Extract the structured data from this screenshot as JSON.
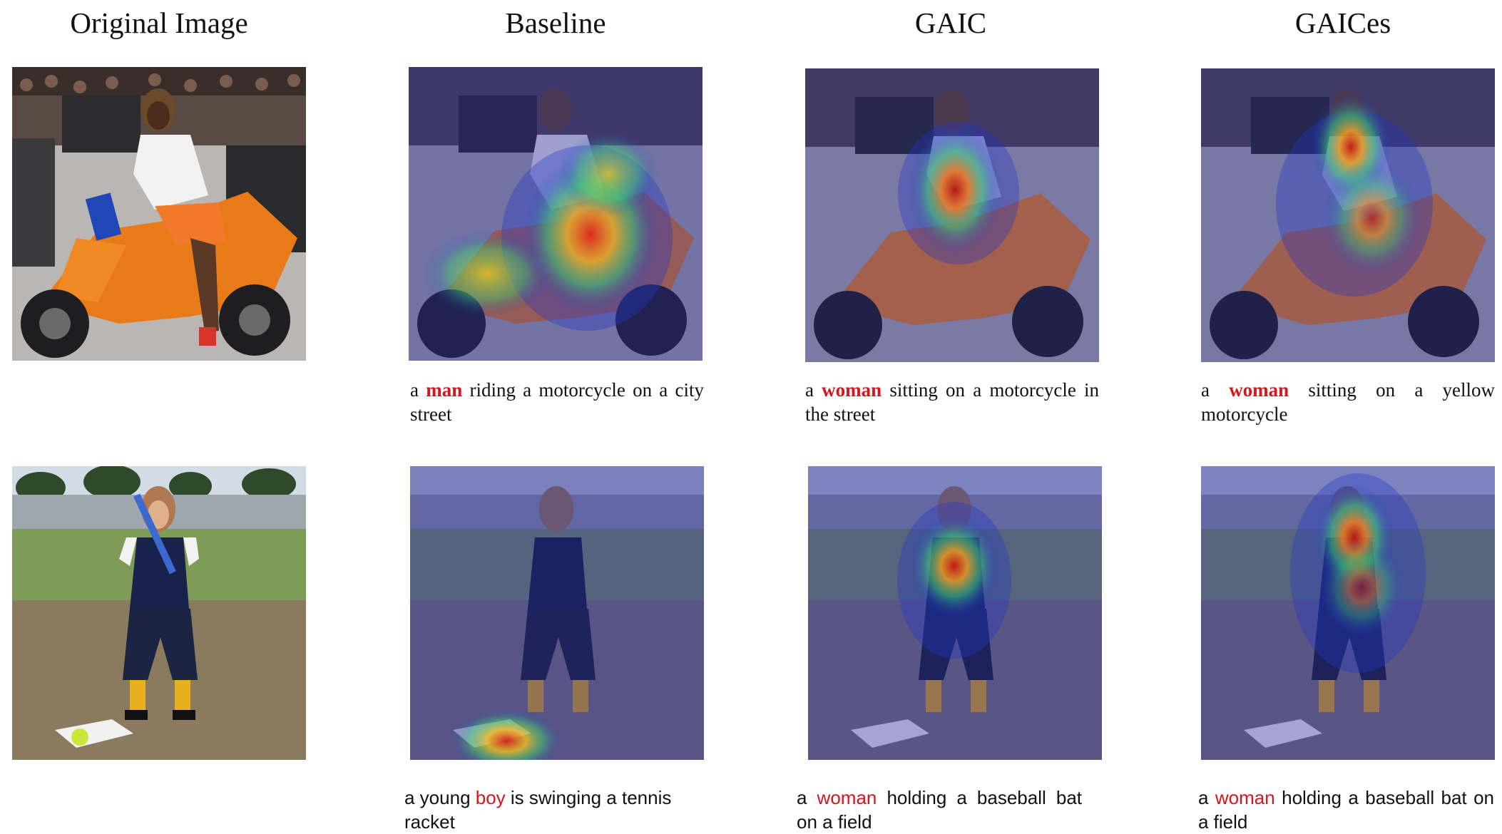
{
  "columns": [
    "Original Image",
    "Baseline",
    "GAIC",
    "GAICes"
  ],
  "rows": [
    {
      "captions": [
        null,
        {
          "pre": "a ",
          "hl": "man",
          "post": " riding a motorcycle on a city street"
        },
        {
          "pre": "a ",
          "hl": "woman",
          "post": " sitting on a motorcycle in the street"
        },
        {
          "pre": "a ",
          "hl": "woman",
          "post": " sitting on a yellow motorcycle"
        }
      ]
    },
    {
      "captions": [
        null,
        {
          "pre": "a young ",
          "hl": "boy",
          "post": " is swinging a tennis racket"
        },
        {
          "pre": "a ",
          "hl": "woman",
          "post": " holding a baseball bat on a field"
        },
        {
          "pre": "a ",
          "hl": "woman",
          "post": " holding a baseball bat on a field"
        }
      ]
    }
  ],
  "colors": {
    "highlight": "#d8141c",
    "text": "#111111"
  }
}
